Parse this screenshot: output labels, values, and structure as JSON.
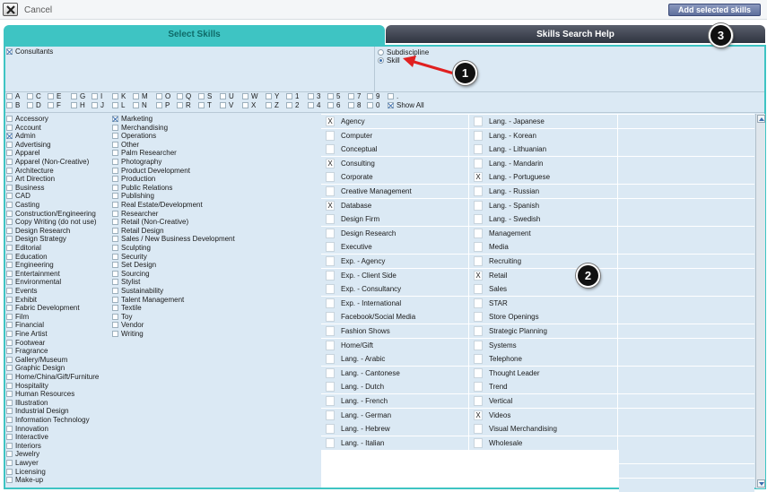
{
  "toolbar": {
    "cancel_label": "Cancel",
    "add_label": "Add selected skills"
  },
  "tabs": {
    "select": "Select Skills",
    "help": "Skills Search Help"
  },
  "consultants": {
    "label": "Consultants",
    "checked": true
  },
  "mode": [
    {
      "label": "Subdiscipline",
      "selected": false
    },
    {
      "label": "Skill",
      "selected": true
    }
  ],
  "letters": {
    "row1": [
      "A",
      "C",
      "E",
      "G",
      "I",
      "K",
      "M",
      "O",
      "Q",
      "S",
      "U",
      "W",
      "Y",
      "1",
      "3",
      "5",
      "7",
      "9",
      "."
    ],
    "row2": [
      "B",
      "D",
      "F",
      "H",
      "J",
      "L",
      "N",
      "P",
      "R",
      "T",
      "V",
      "X",
      "Z",
      "2",
      "4",
      "6",
      "8",
      "0"
    ],
    "show_all": "Show All"
  },
  "categories": {
    "col1": [
      {
        "label": "Accessory",
        "checked": false
      },
      {
        "label": "Account",
        "checked": false
      },
      {
        "label": "Admin",
        "checked": true
      },
      {
        "label": "Advertising",
        "checked": false
      },
      {
        "label": "Apparel",
        "checked": false
      },
      {
        "label": "Apparel (Non-Creative)",
        "checked": false
      },
      {
        "label": "Architecture",
        "checked": false
      },
      {
        "label": "Art Direction",
        "checked": false
      },
      {
        "label": "Business",
        "checked": false
      },
      {
        "label": "CAD",
        "checked": false
      },
      {
        "label": "Casting",
        "checked": false
      },
      {
        "label": "Construction/Engineering",
        "checked": false
      },
      {
        "label": "Copy Writing (do not use)",
        "checked": false
      },
      {
        "label": "Design Research",
        "checked": false
      },
      {
        "label": "Design Strategy",
        "checked": false
      },
      {
        "label": "Editorial",
        "checked": false
      },
      {
        "label": "Education",
        "checked": false
      },
      {
        "label": "Engineering",
        "checked": false
      },
      {
        "label": "Entertainment",
        "checked": false
      },
      {
        "label": "Environmental",
        "checked": false
      },
      {
        "label": "Events",
        "checked": false
      },
      {
        "label": "Exhibit",
        "checked": false
      },
      {
        "label": "Fabric Development",
        "checked": false
      },
      {
        "label": "Film",
        "checked": false
      },
      {
        "label": "Financial",
        "checked": false
      },
      {
        "label": "Fine Artist",
        "checked": false
      },
      {
        "label": "Footwear",
        "checked": false
      },
      {
        "label": "Fragrance",
        "checked": false
      },
      {
        "label": "Gallery/Museum",
        "checked": false
      },
      {
        "label": "Graphic Design",
        "checked": false
      },
      {
        "label": "Home/China/Gift/Furniture",
        "checked": false
      },
      {
        "label": "Hospitality",
        "checked": false
      },
      {
        "label": "Human Resources",
        "checked": false
      },
      {
        "label": "Illustration",
        "checked": false
      },
      {
        "label": "Industrial Design",
        "checked": false
      },
      {
        "label": "Information Technology",
        "checked": false
      },
      {
        "label": "Innovation",
        "checked": false
      },
      {
        "label": "Interactive",
        "checked": false
      },
      {
        "label": "Interiors",
        "checked": false
      },
      {
        "label": "Jewelry",
        "checked": false
      },
      {
        "label": "Lawyer",
        "checked": false
      },
      {
        "label": "Licensing",
        "checked": false
      },
      {
        "label": "Make-up",
        "checked": false
      }
    ],
    "col2": [
      {
        "label": "Marketing",
        "checked": true
      },
      {
        "label": "Merchandising",
        "checked": false
      },
      {
        "label": "Operations",
        "checked": false
      },
      {
        "label": "Other",
        "checked": false
      },
      {
        "label": "Palm Researcher",
        "checked": false
      },
      {
        "label": "Photography",
        "checked": false
      },
      {
        "label": "Product Development",
        "checked": false
      },
      {
        "label": "Production",
        "checked": false
      },
      {
        "label": "Public Relations",
        "checked": false
      },
      {
        "label": "Publishing",
        "checked": false
      },
      {
        "label": "Real Estate/Development",
        "checked": false
      },
      {
        "label": "Researcher",
        "checked": false
      },
      {
        "label": "Retail  (Non-Creative)",
        "checked": false
      },
      {
        "label": "Retail Design",
        "checked": false
      },
      {
        "label": "Sales / New Business Development",
        "checked": false
      },
      {
        "label": "Sculpting",
        "checked": false
      },
      {
        "label": "Security",
        "checked": false
      },
      {
        "label": "Set Design",
        "checked": false
      },
      {
        "label": "Sourcing",
        "checked": false
      },
      {
        "label": "Stylist",
        "checked": false
      },
      {
        "label": "Sustainability",
        "checked": false
      },
      {
        "label": "Talent Management",
        "checked": false
      },
      {
        "label": "Textile",
        "checked": false
      },
      {
        "label": "Toy",
        "checked": false
      },
      {
        "label": "Vendor",
        "checked": false
      },
      {
        "label": "Writing",
        "checked": false
      }
    ]
  },
  "skills": {
    "col1": [
      {
        "label": "Agency",
        "checked": true
      },
      {
        "label": "Computer",
        "checked": false
      },
      {
        "label": "Conceptual",
        "checked": false
      },
      {
        "label": "Consulting",
        "checked": true
      },
      {
        "label": "Corporate",
        "checked": false
      },
      {
        "label": "Creative Management",
        "checked": false
      },
      {
        "label": "Database",
        "checked": true
      },
      {
        "label": "Design Firm",
        "checked": false
      },
      {
        "label": "Design Research",
        "checked": false
      },
      {
        "label": "Executive",
        "checked": false
      },
      {
        "label": "Exp. - Agency",
        "checked": false
      },
      {
        "label": "Exp. - Client Side",
        "checked": false
      },
      {
        "label": "Exp. - Consultancy",
        "checked": false
      },
      {
        "label": "Exp. - International",
        "checked": false
      },
      {
        "label": "Facebook/Social Media",
        "checked": false
      },
      {
        "label": "Fashion Shows",
        "checked": false
      },
      {
        "label": "Home/Gift",
        "checked": false
      },
      {
        "label": "Lang. - Arabic",
        "checked": false
      },
      {
        "label": "Lang. - Cantonese",
        "checked": false
      },
      {
        "label": "Lang. - Dutch",
        "checked": false
      },
      {
        "label": "Lang. - French",
        "checked": false
      },
      {
        "label": "Lang. - German",
        "checked": false
      },
      {
        "label": "Lang. - Hebrew",
        "checked": false
      },
      {
        "label": "Lang. - Italian",
        "checked": false
      }
    ],
    "col2": [
      {
        "label": "Lang. - Japanese",
        "checked": false
      },
      {
        "label": "Lang. - Korean",
        "checked": false
      },
      {
        "label": "Lang. - Lithuanian",
        "checked": false
      },
      {
        "label": "Lang. - Mandarin",
        "checked": false
      },
      {
        "label": "Lang. - Portuguese",
        "checked": true
      },
      {
        "label": "Lang. - Russian",
        "checked": false
      },
      {
        "label": "Lang. - Spanish",
        "checked": false
      },
      {
        "label": "Lang. - Swedish",
        "checked": false
      },
      {
        "label": "Management",
        "checked": false
      },
      {
        "label": "Media",
        "checked": false
      },
      {
        "label": "Recruiting",
        "checked": false
      },
      {
        "label": "Retail",
        "checked": true
      },
      {
        "label": "Sales",
        "checked": false
      },
      {
        "label": "STAR",
        "checked": false
      },
      {
        "label": "Store Openings",
        "checked": false
      },
      {
        "label": "Strategic Planning",
        "checked": false
      },
      {
        "label": "Systems",
        "checked": false
      },
      {
        "label": "Telephone",
        "checked": false
      },
      {
        "label": "Thought Leader",
        "checked": false
      },
      {
        "label": "Trend",
        "checked": false
      },
      {
        "label": "Vertical",
        "checked": false
      },
      {
        "label": "Videos",
        "checked": true
      },
      {
        "label": "Visual Merchandising",
        "checked": false
      },
      {
        "label": "Wholesale",
        "checked": false
      }
    ]
  },
  "checkmark": "X",
  "annotations": [
    "1",
    "2",
    "3"
  ],
  "colors": {
    "teal": "#3ec4c3",
    "panel": "#dbe9f4",
    "arrow": "#e02020",
    "help_tab": "#2f3440",
    "button": "#5e6f9c"
  }
}
